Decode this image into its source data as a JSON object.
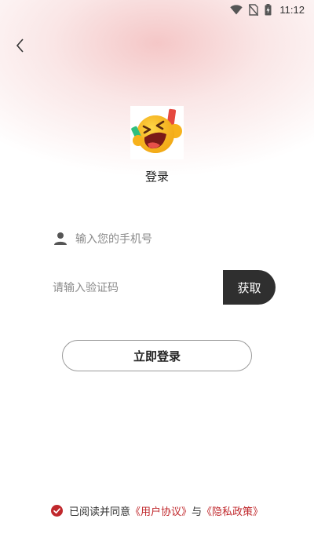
{
  "status_bar": {
    "time": "11:12",
    "icons": [
      "wifi-icon",
      "no-sim-icon",
      "battery-charging-icon"
    ]
  },
  "header": {
    "back_icon": "chevron-left-icon"
  },
  "logo": {
    "icon": "laughing-emoji-logo"
  },
  "title": "登录",
  "phone_field": {
    "icon": "user-icon",
    "placeholder": "输入您的手机号",
    "value": ""
  },
  "code_field": {
    "placeholder": "请输入验证码",
    "value": "",
    "get_code_label": "获取"
  },
  "login_button_label": "立即登录",
  "agreement": {
    "checked": true,
    "prefix": "已阅读并同意",
    "user_agreement": "《用户协议》",
    "and": "与",
    "privacy_policy": "《隐私政策》"
  },
  "colors": {
    "accent": "#c0282c",
    "dark_button": "#2f2f2f",
    "header_gradient": "#f4c4c4"
  }
}
